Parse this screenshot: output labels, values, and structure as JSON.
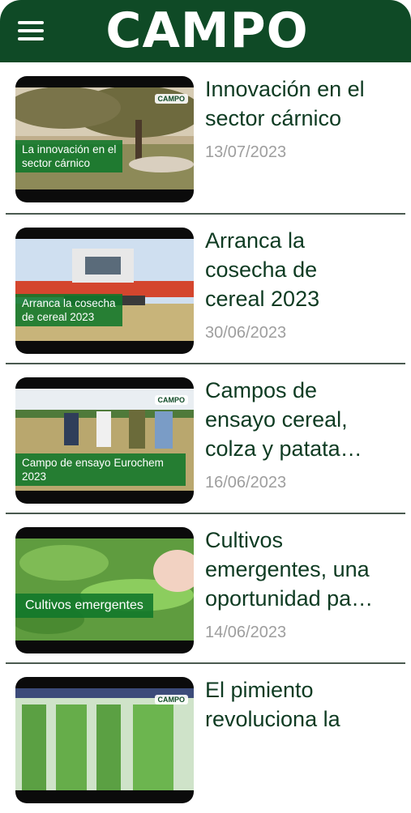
{
  "header": {
    "brand": "CAMPO",
    "menu_icon": "hamburger-menu-icon"
  },
  "articles": [
    {
      "title": "Innovación en el\nsector cárnico",
      "date": "13/07/2023",
      "thumb_caption": "La innovación en el\nsector cárnico",
      "thumb_logo": "CAMPO"
    },
    {
      "title": "Arranca la\ncosecha de\ncereal 2023",
      "date": "30/06/2023",
      "thumb_caption": "Arranca la cosecha\nde cereal 2023",
      "thumb_logo": ""
    },
    {
      "title": "Campos de\nensayo cereal,\ncolza y patata…",
      "date": "16/06/2023",
      "thumb_caption": "Campo de ensayo Eurochem 2023",
      "thumb_logo": "CAMPO"
    },
    {
      "title": "Cultivos\nemergentes, una\noportunidad pa…",
      "date": "14/06/2023",
      "thumb_caption": "Cultivos emergentes",
      "thumb_logo": ""
    },
    {
      "title": "El pimiento\nrevoluciona la",
      "date": "",
      "thumb_caption": "",
      "thumb_logo": "CAMPO"
    }
  ]
}
